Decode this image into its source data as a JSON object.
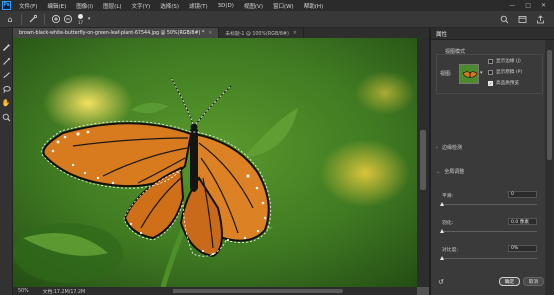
{
  "app": {
    "logo": "Ps"
  },
  "menu": [
    "文件(F)",
    "编辑(E)",
    "图像(I)",
    "图层(L)",
    "文字(Y)",
    "选择(S)",
    "滤镜(T)",
    "3D(D)",
    "视图(V)",
    "窗口(W)",
    "帮助(H)"
  ],
  "window_controls": {
    "minimize": "—",
    "maximize": "□",
    "close": "✕"
  },
  "options": {
    "brush_size": "17"
  },
  "tabs": [
    {
      "label": "brown-black-white-butterfly-on-green-leaf-plant-67544.jpg @ 50%(RGB/8#) *",
      "close": "×",
      "active": true
    },
    {
      "label": "未标题-1 @ 100%(RGB/8#)",
      "close": "×",
      "active": false
    }
  ],
  "status": {
    "zoom": "50%",
    "doc": "文档:17.2M/17.2M"
  },
  "properties": {
    "title": "属性",
    "view_mode_label": "视图模式",
    "view_label": "视图:",
    "checks": [
      {
        "label": "显示边缘 (J)",
        "checked": false
      },
      {
        "label": "显示原稿 (P)",
        "checked": false
      },
      {
        "label": "高品质预览",
        "checked": true
      }
    ],
    "edge_detection": "边缘检测",
    "global_refine": "全局调整",
    "sliders": [
      {
        "label": "平滑:",
        "value": "0"
      },
      {
        "label": "羽化:",
        "value": "0.0 像素"
      },
      {
        "label": "对比度:",
        "value": "0%"
      }
    ],
    "ok_label": "确定",
    "cancel_label": "取消"
  },
  "colors": {
    "accent": "#31a8ff",
    "panel": "#3a3a3a",
    "menubar": "#2b2b2b"
  }
}
